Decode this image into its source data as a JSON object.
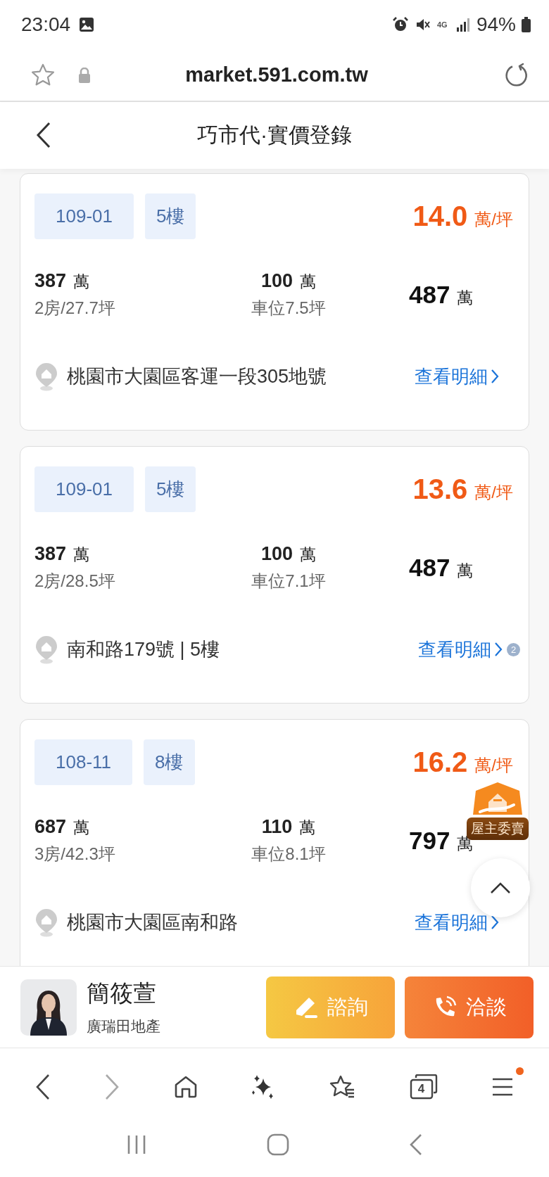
{
  "status_bar": {
    "time": "23:04",
    "network": "4G",
    "battery": "94%"
  },
  "address_bar": {
    "url": "market.591.com.tw"
  },
  "header": {
    "title": "巧市代·實價登錄"
  },
  "records": [
    {
      "date": "109-01",
      "floor": "5樓",
      "unit_price": "14.0",
      "unit_price_unit": "萬/坪",
      "house_price": "387",
      "house_price_unit": "萬",
      "house_detail": "2房/27.7坪",
      "parking_price": "100",
      "parking_price_unit": "萬",
      "parking_detail": "車位7.5坪",
      "total_price": "487",
      "total_price_unit": "萬",
      "address": "桃園市大園區客運一段305地號",
      "detail_link": "查看明細"
    },
    {
      "date": "109-01",
      "floor": "5樓",
      "unit_price": "13.6",
      "unit_price_unit": "萬/坪",
      "house_price": "387",
      "house_price_unit": "萬",
      "house_detail": "2房/28.5坪",
      "parking_price": "100",
      "parking_price_unit": "萬",
      "parking_detail": "車位7.1坪",
      "total_price": "487",
      "total_price_unit": "萬",
      "address": "南和路179號 | 5樓",
      "detail_link": "查看明細",
      "badge": "2"
    },
    {
      "date": "108-11",
      "floor": "8樓",
      "unit_price": "16.2",
      "unit_price_unit": "萬/坪",
      "house_price": "687",
      "house_price_unit": "萬",
      "house_detail": "3房/42.3坪",
      "parking_price": "110",
      "parking_price_unit": "萬",
      "parking_detail": "車位8.1坪",
      "total_price": "797",
      "total_price_unit": "萬",
      "address": "桃園市大園區南和路",
      "detail_link": "查看明細"
    }
  ],
  "owner_badge": {
    "label": "屋主委賣"
  },
  "agent": {
    "name": "簡筱萱",
    "company": "廣瑞田地產"
  },
  "actions": [
    {
      "kind": "inquire",
      "label": "諮詢"
    },
    {
      "kind": "call",
      "label": "洽談"
    }
  ],
  "browser_nav": [
    {
      "kind": "back",
      "disabled": false
    },
    {
      "kind": "forward",
      "disabled": true
    },
    {
      "kind": "home",
      "disabled": false
    },
    {
      "kind": "assistant",
      "disabled": false
    },
    {
      "kind": "bookmarks",
      "disabled": false
    },
    {
      "kind": "tabs",
      "disabled": false,
      "count": "4"
    },
    {
      "kind": "menu",
      "disabled": false,
      "notification": true
    }
  ]
}
